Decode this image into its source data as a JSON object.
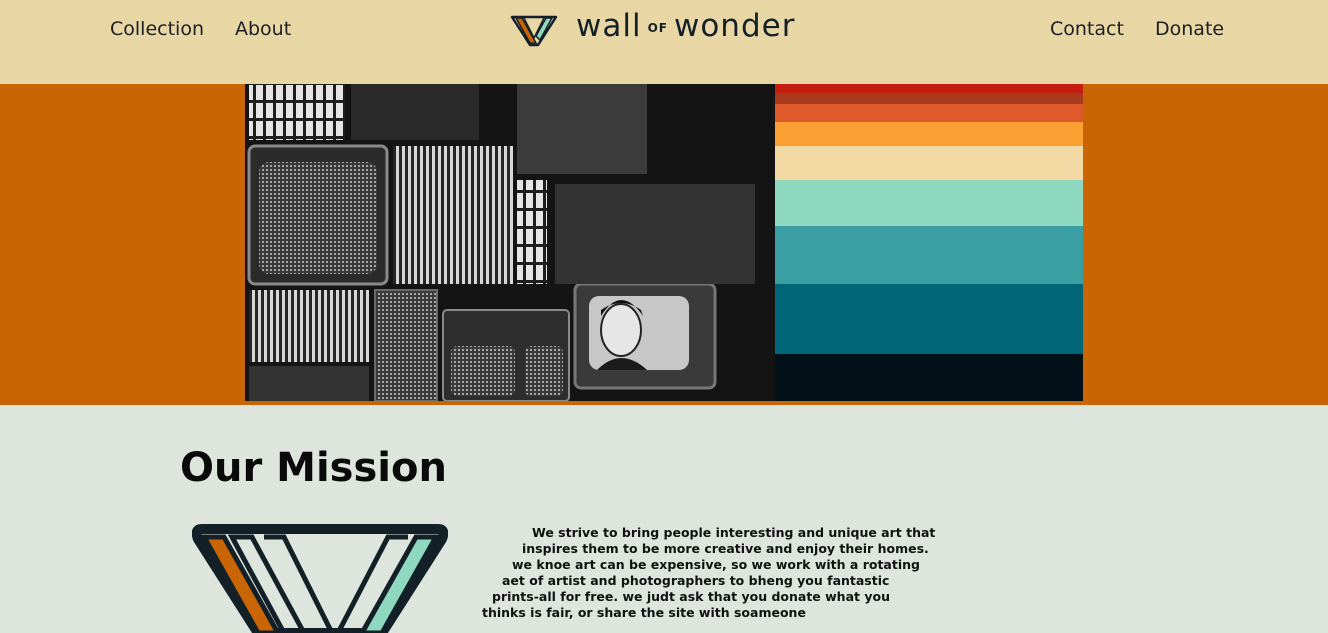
{
  "nav": {
    "left": [
      "Collection",
      "About"
    ],
    "right": [
      "Contact",
      "Donate"
    ]
  },
  "logo": {
    "word1": "wall",
    "of": "OF",
    "word2": "wonder"
  },
  "hero": {
    "stripe_colors": [
      "#c41d0f",
      "#e0592a",
      "#fda033",
      "#f3d9a3",
      "#8ed8c0",
      "#3a9ea3",
      "#006577",
      "#001016"
    ]
  },
  "mission": {
    "title": "Our Mission",
    "lines": [
      "We strive to bring people interesting and unique art that",
      "inspires them to be more creative and enjoy their homes.",
      "we knoe art can be expensive, so we work with a rotating",
      "aet of artist and photographers to bheng you fantastic",
      "prints-all for free. we judt ask that you donate what you",
      "thinks is fair, or share the site with soameone"
    ]
  },
  "colors": {
    "header_bg": "#e8d7a5",
    "hero_bg": "#c96504",
    "body_bg": "#dde5dd",
    "accent_orange": "#c96504",
    "accent_teal": "#8ed8c0"
  }
}
